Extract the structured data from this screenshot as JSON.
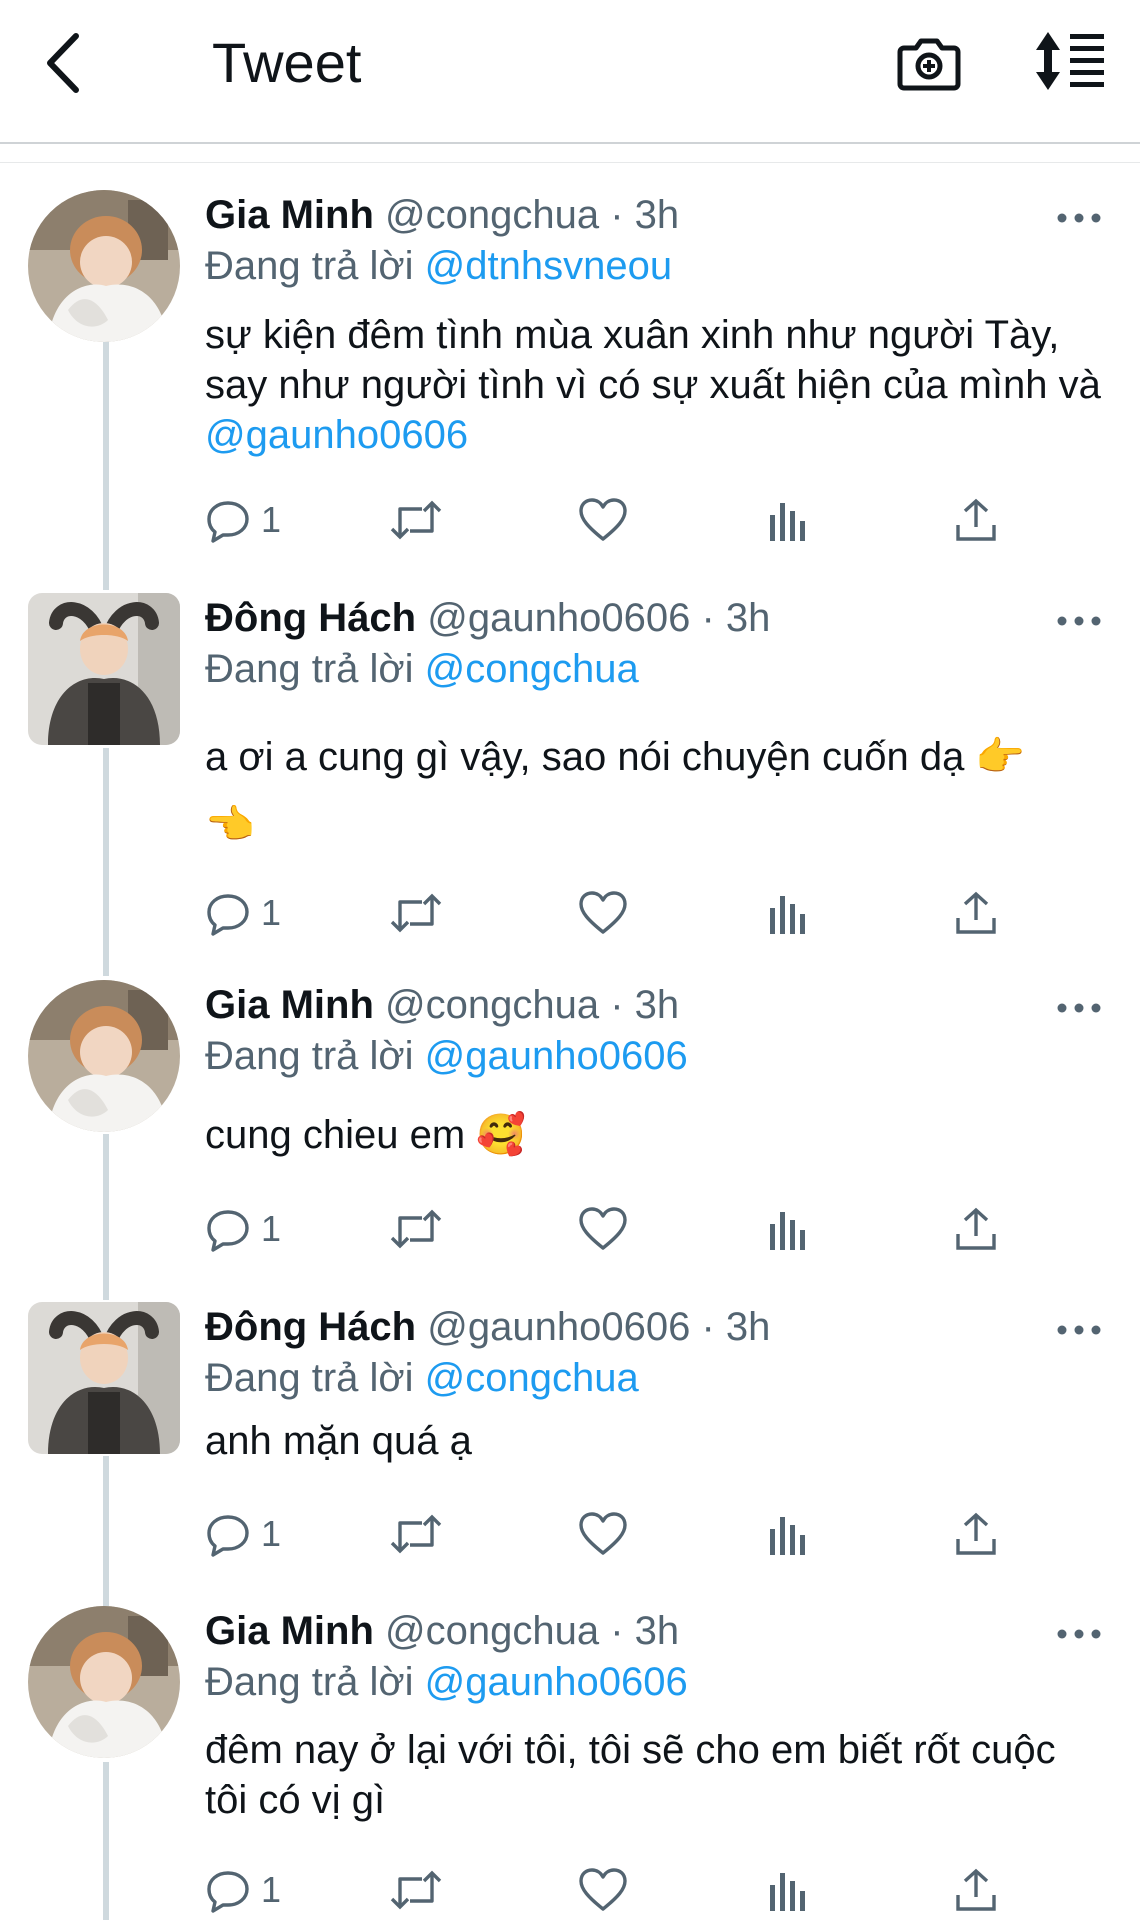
{
  "header": {
    "title": "Tweet"
  },
  "tweets": [
    {
      "name": "Gia Minh",
      "handle": "@congchua",
      "time": "· 3h",
      "reply_prefix": "Đang trả lời",
      "reply_to": "@dtnhsvneou",
      "text": "sự kiện đêm tình mùa xuân xinh như người Tày, say như người tình vì có sự xuất hiện của mình và ",
      "text_mention": "@gaunho0606",
      "reply_count": "1",
      "avatar_icon": "avatar-photo"
    },
    {
      "name": "Đông Hách",
      "handle": "@gaunho0606",
      "time": "· 3h",
      "reply_prefix": "Đang trả lời",
      "reply_to": "@congchua",
      "text": "a ơi a cung gì vậy, sao nói chuyện cuốn dạ 👉 👈",
      "reply_count": "1",
      "avatar_icon": "avatar-photo"
    },
    {
      "name": "Gia Minh",
      "handle": "@congchua",
      "time": "· 3h",
      "reply_prefix": "Đang trả lời",
      "reply_to": "@gaunho0606",
      "text": "cung chieu em 🥰",
      "reply_count": "1",
      "avatar_icon": "avatar-photo"
    },
    {
      "name": "Đông Hách",
      "handle": "@gaunho0606",
      "time": "· 3h",
      "reply_prefix": "Đang trả lời",
      "reply_to": "@congchua",
      "text": "anh mặn quá ạ",
      "reply_count": "1",
      "avatar_icon": "avatar-photo"
    },
    {
      "name": "Gia Minh",
      "handle": "@congchua",
      "time": "· 3h",
      "reply_prefix": "Đang trả lời",
      "reply_to": "@gaunho0606",
      "text": "đêm nay ở lại với tôi, tôi sẽ cho em biết rốt cuộc tôi có vị gì",
      "reply_count": "1",
      "avatar_icon": "avatar-photo"
    }
  ],
  "colors": {
    "accent": "#1d9bf0",
    "muted": "#536471",
    "text": "#0f1419"
  },
  "icons": [
    "back-arrow-icon",
    "camera-icon",
    "sort-icon",
    "more-icon",
    "reply-icon",
    "retweet-icon",
    "like-icon",
    "analytics-icon",
    "share-icon"
  ]
}
